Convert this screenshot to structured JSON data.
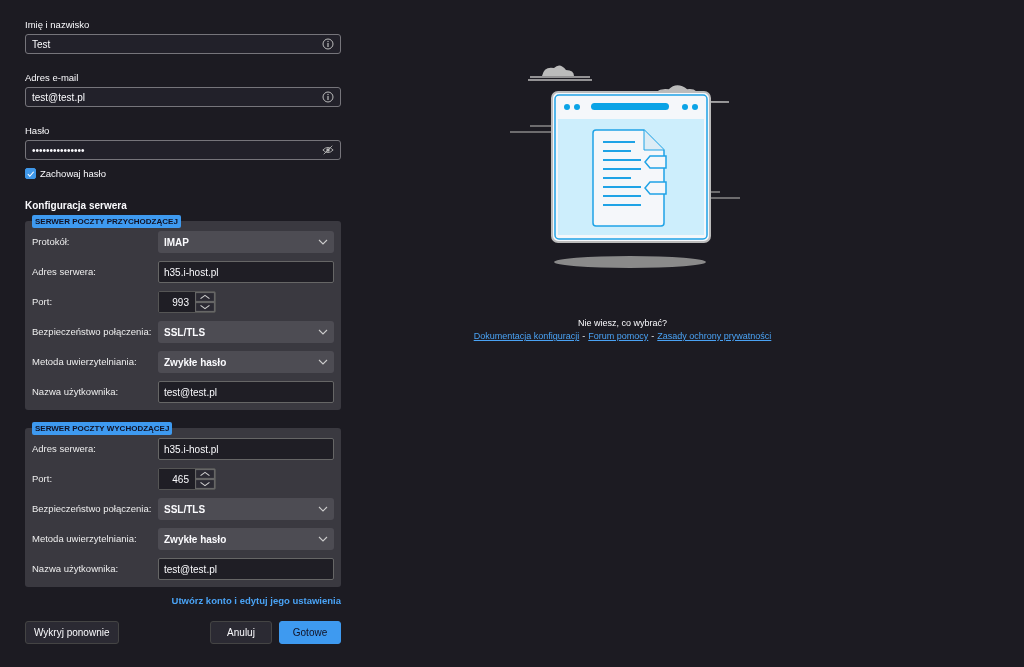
{
  "fields": [
    {
      "label": "Imię i nazwisko",
      "value": "Test",
      "kind": "info"
    },
    {
      "label": "Adres e-mail",
      "value": "test@test.pl",
      "kind": "info"
    },
    {
      "label": "Hasło",
      "value": "•••••••••••••••",
      "kind": "password"
    }
  ],
  "remember_password": {
    "label": "Zachowaj hasło",
    "checked": true
  },
  "server_config": {
    "title": "Konfiguracja serwera",
    "groups": [
      {
        "legend": "SERWER POCZTY PRZYCHODZĄCEJ",
        "rows": [
          {
            "label": "Protokół:",
            "value": "IMAP",
            "kind": "select"
          },
          {
            "label": "Adres serwera:",
            "value": "h35.i-host.pl",
            "kind": "text"
          },
          {
            "label": "Port:",
            "value": "993",
            "kind": "port"
          },
          {
            "label": "Bezpieczeństwo połączenia:",
            "value": "SSL/TLS",
            "kind": "select"
          },
          {
            "label": "Metoda uwierzytelniania:",
            "value": "Zwykłe hasło",
            "kind": "select"
          },
          {
            "label": "Nazwa użytkownika:",
            "value": "test@test.pl",
            "kind": "text"
          }
        ]
      },
      {
        "legend": "SERWER POCZTY WYCHODZĄCEJ",
        "rows": [
          {
            "label": "Adres serwera:",
            "value": "h35.i-host.pl",
            "kind": "text"
          },
          {
            "label": "Port:",
            "value": "465",
            "kind": "port"
          },
          {
            "label": "Bezpieczeństwo połączenia:",
            "value": "SSL/TLS",
            "kind": "select"
          },
          {
            "label": "Metoda uwierzytelniania:",
            "value": "Zwykłe hasło",
            "kind": "select"
          },
          {
            "label": "Nazwa użytkownika:",
            "value": "test@test.pl",
            "kind": "text"
          }
        ]
      }
    ],
    "advanced_link": "Utwórz konto i edytuj jego ustawienia"
  },
  "buttons": {
    "retest": "Wykryj ponownie",
    "cancel": "Anuluj",
    "done": "Gotowe"
  },
  "help": {
    "question": "Nie wiesz, co wybrać?",
    "links": [
      "Dokumentacja konfiguracji",
      "Forum pomocy",
      "Zasady ochrony prywatności"
    ],
    "separator": "-"
  }
}
